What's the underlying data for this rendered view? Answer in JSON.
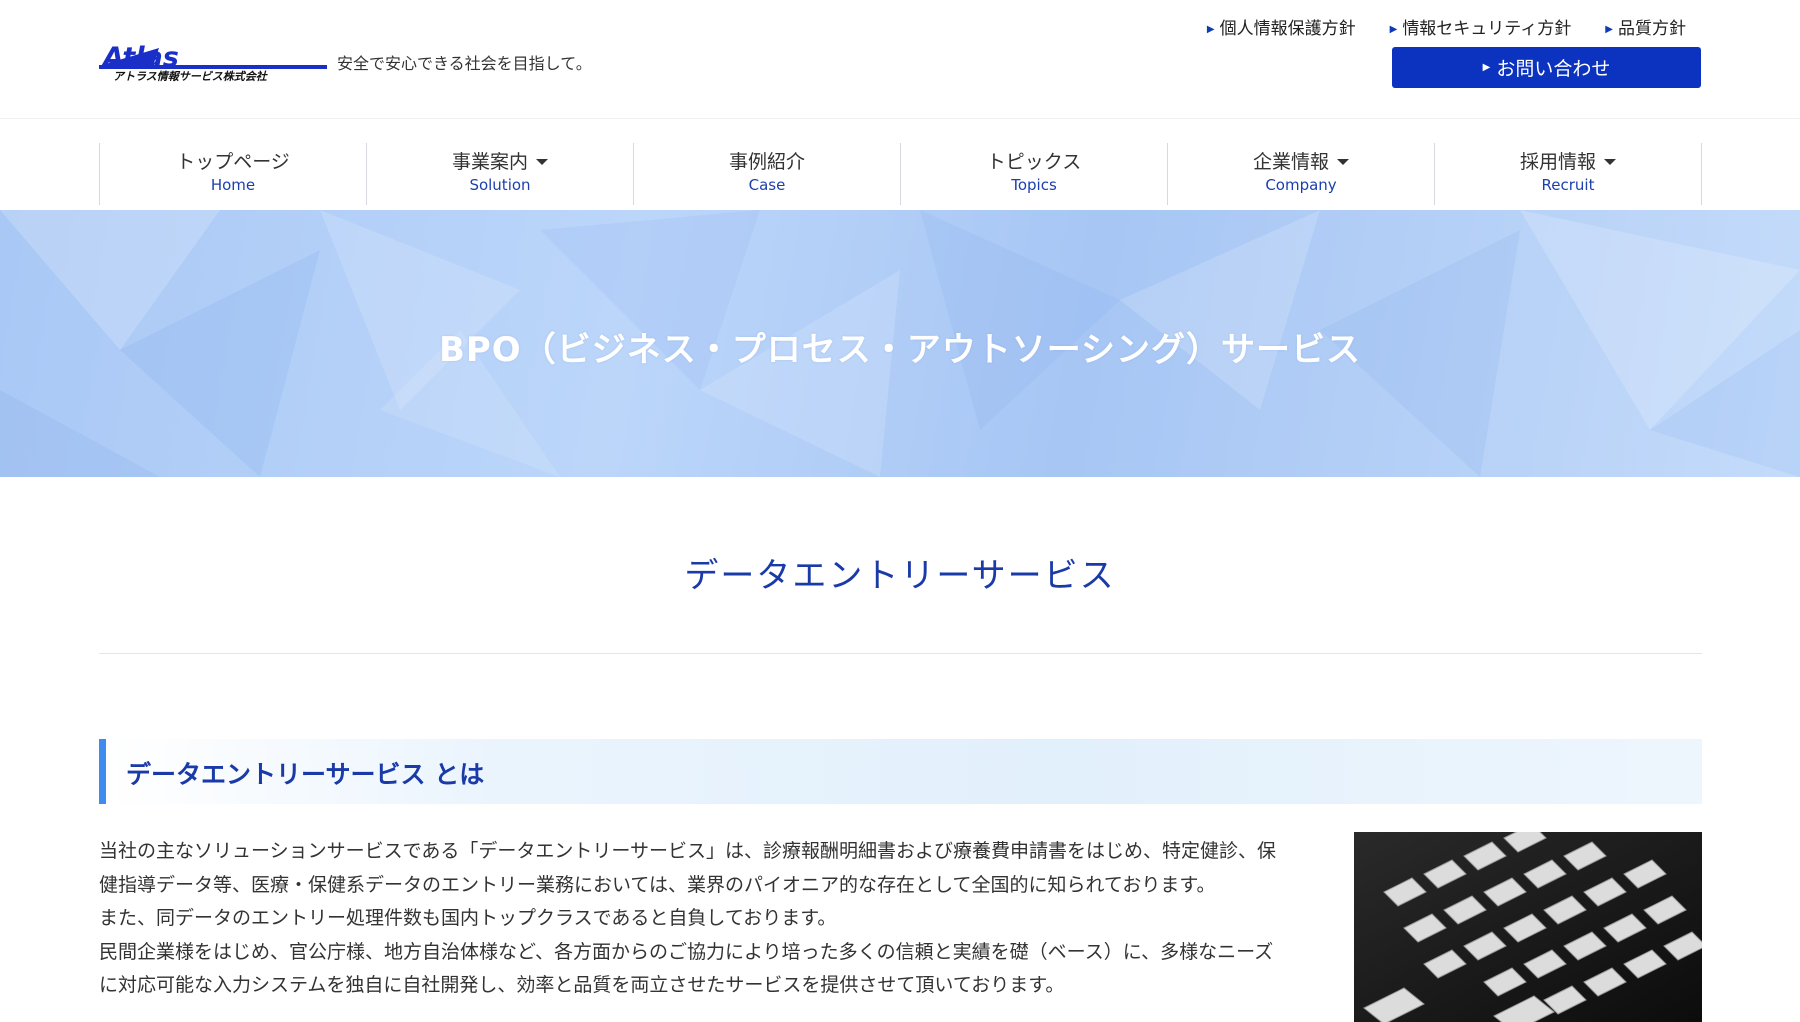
{
  "header": {
    "logo_text": "Atlas",
    "logo_subtext": "アトラス情報サービス株式会社",
    "tagline": "安全で安心できる社会を目指して。",
    "util_links": [
      "個人情報保護方針",
      "情報セキュリティ方針",
      "品質方針"
    ],
    "contact_label": "お問い合わせ"
  },
  "nav": [
    {
      "jp": "トップページ",
      "en": "Home"
    },
    {
      "jp": "事業案内",
      "en": "Solution"
    },
    {
      "jp": "事例紹介",
      "en": "Case"
    },
    {
      "jp": "トピックス",
      "en": "Topics"
    },
    {
      "jp": "企業情報",
      "en": "Company"
    },
    {
      "jp": "採用情報",
      "en": "Recruit"
    }
  ],
  "hero": {
    "title": "BPO（ビジネス・プロセス・アウトソーシング）サービス"
  },
  "section": {
    "title": "データエントリーサービス",
    "subheading": "データエントリーサービス とは",
    "paragraphs": [
      "当社の主なソリューションサービスである「データエントリーサービス」は、診療報酬明細書および療養費申請書をはじめ、特定健診、保健指導データ等、医療・保健系データのエントリー業務においては、業界のパイオニア的な存在として全国的に知られております。",
      "また、同データのエントリー処理件数も国内トップクラスであると自負しております。",
      "民間企業様をはじめ、官公庁様、地方自治体様など、各方面からのご協力により培った多くの信頼と実績を礎（ベース）に、多様なニーズに対応可能な入力システムを独自に自社開発し、効率と品質を両立させたサービスを提供させて頂いております。"
    ]
  },
  "colors": {
    "accent": "#0b33c0",
    "nav_en": "#1c3fb0",
    "heading": "#1a3aa8",
    "bar": "#3f8bee"
  },
  "icons": [
    "triangle-right-icon",
    "caret-down-icon"
  ]
}
